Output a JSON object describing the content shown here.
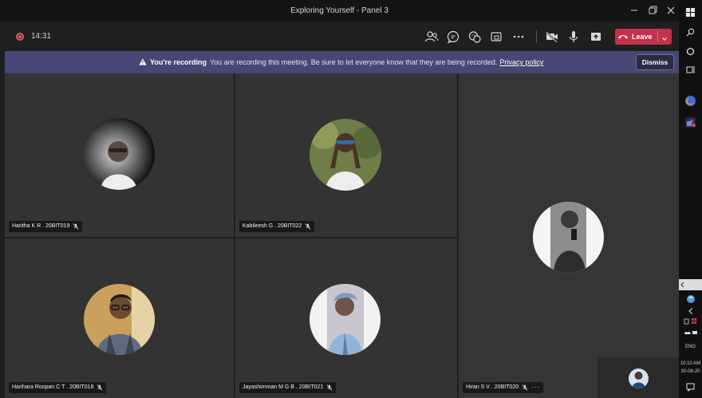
{
  "window": {
    "title": "Exploring Yourself - Panel 3",
    "minimize_icon": "minimize-icon",
    "restore_icon": "restore-icon",
    "close_icon": "close-icon"
  },
  "toolbar": {
    "timer": "14:31",
    "leave_label": "Leave",
    "icons": [
      "people-icon",
      "chat-icon",
      "reactions-icon",
      "share-tray-icon",
      "more-icon",
      "camera-off-icon",
      "mic-icon",
      "share-screen-icon"
    ]
  },
  "banner": {
    "title": "You're recording",
    "message": "You are recording this meeting. Be sure to let everyone know that they are being recorded.",
    "link": "Privacy policy",
    "dismiss_label": "Dismiss"
  },
  "participants": [
    {
      "name": "Haritha K R . 20BIT019",
      "muted": true
    },
    {
      "name": "Kabileesh G . 20BIT022",
      "muted": true
    },
    {
      "name": "Hiran S V . 20BIT020",
      "muted": true,
      "more": "···"
    },
    {
      "name": "Harihara Roopan C T . 20BIT018",
      "muted": true
    },
    {
      "name": "Jayashimman M G B . 20BIT021",
      "muted": true
    }
  ],
  "taskbar": {
    "language": "ENG",
    "time": "10:10 AM",
    "date": "30-08-20",
    "icons": [
      "windows-start-icon",
      "search-icon",
      "cortana-icon",
      "task-view-icon",
      "firefox-icon",
      "teams-icon"
    ]
  },
  "colors": {
    "banner": "#464775",
    "leave": "#c4314b",
    "tile": "#333333",
    "recording": "#e05b67"
  }
}
